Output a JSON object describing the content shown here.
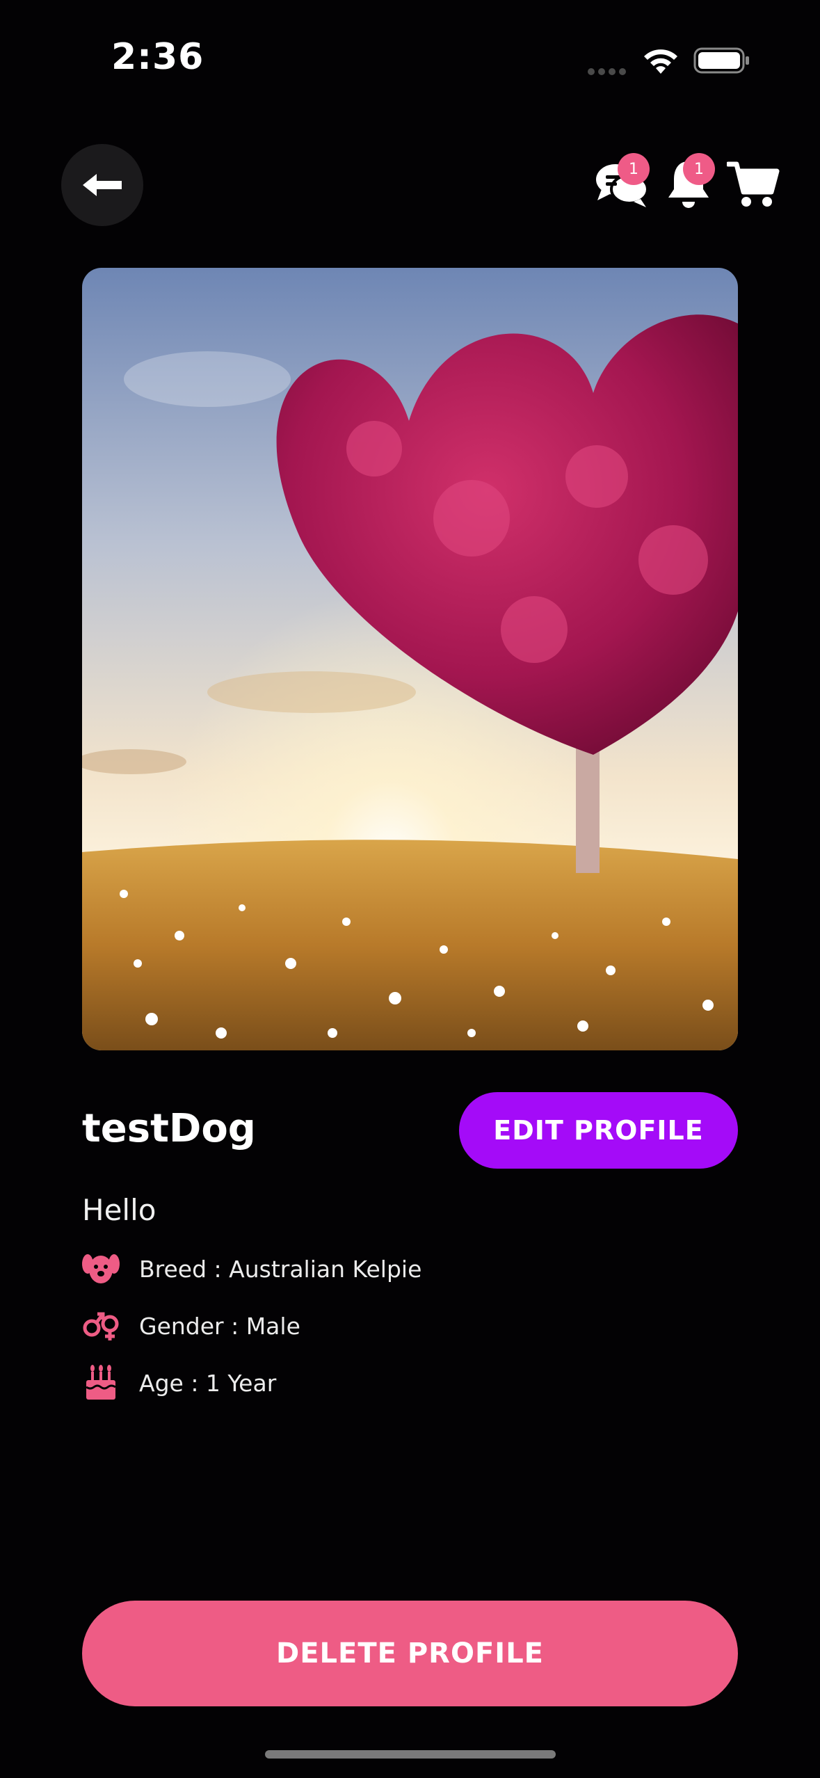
{
  "status_bar": {
    "time": "2:36"
  },
  "header": {
    "chat_badge_count": "1",
    "notification_badge_count": "1"
  },
  "profile": {
    "name": "testDog",
    "edit_button_label": "EDIT PROFILE",
    "bio": "Hello",
    "details": {
      "breed": "Breed : Australian Kelpie",
      "gender": "Gender : Male",
      "age": "Age : 1 Year"
    },
    "delete_button_label": "DELETE PROFILE"
  },
  "colors": {
    "background": "#030204",
    "accent_pink": "#ee5c85",
    "accent_purple": "#a40bf8"
  },
  "icons": {
    "back": "arrow-left-icon",
    "chat": "chat-bubbles-icon",
    "notifications": "bell-icon",
    "cart": "shopping-cart-icon",
    "breed": "dog-face-icon",
    "gender": "gender-icon",
    "age": "birthday-cake-icon"
  }
}
